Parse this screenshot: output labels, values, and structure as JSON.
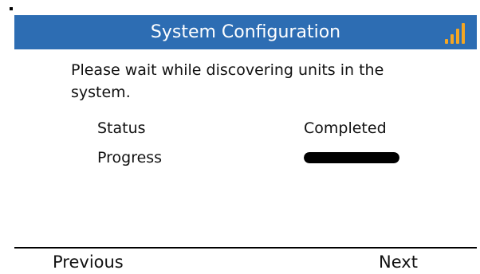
{
  "header": {
    "title": "System Configuration",
    "signal_icon": "signal-strength-icon",
    "signal_level": 4,
    "signal_bar_color": "#f5a623",
    "background_color": "#2d6db3"
  },
  "main": {
    "message": "Please wait while discovering units in the system.",
    "status_label": "Status",
    "status_value": "Completed",
    "progress_label": "Progress",
    "progress_value": 1.0
  },
  "softkeys": {
    "previous_label": "Previous",
    "next_label": "Next"
  }
}
